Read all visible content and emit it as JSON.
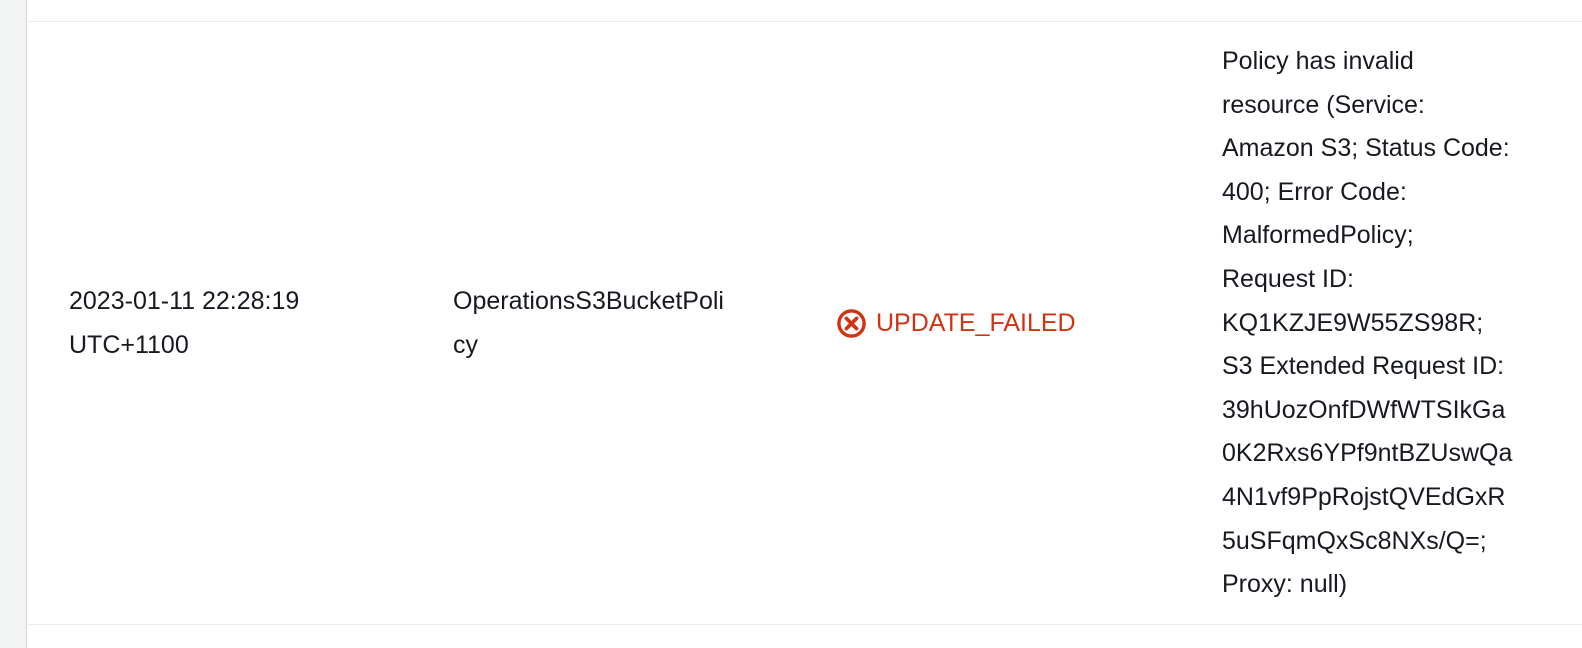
{
  "event_row": {
    "timestamp_lines": [
      "2023-01-11 22:28:19",
      "UTC+1100"
    ],
    "logical_id_lines": [
      "OperationsS3BucketPoli",
      "cy"
    ],
    "status": {
      "label": "UPDATE_FAILED",
      "icon": "error-circle-x-icon",
      "color": "#d13212"
    },
    "status_reason_lines": [
      "Policy has invalid",
      "resource (Service:",
      "Amazon S3; Status Code:",
      "400; Error Code:",
      "MalformedPolicy;",
      "Request ID:",
      "KQ1KZJE9W55ZS98R;",
      "S3 Extended Request ID:",
      "39hUozOnfDWfWTSIkGa",
      "0K2Rxs6YPf9ntBZUswQa",
      "4N1vf9PpRojstQVEdGxR",
      "5uSFqmQxSc8NXs/Q=;",
      "Proxy: null)"
    ]
  }
}
